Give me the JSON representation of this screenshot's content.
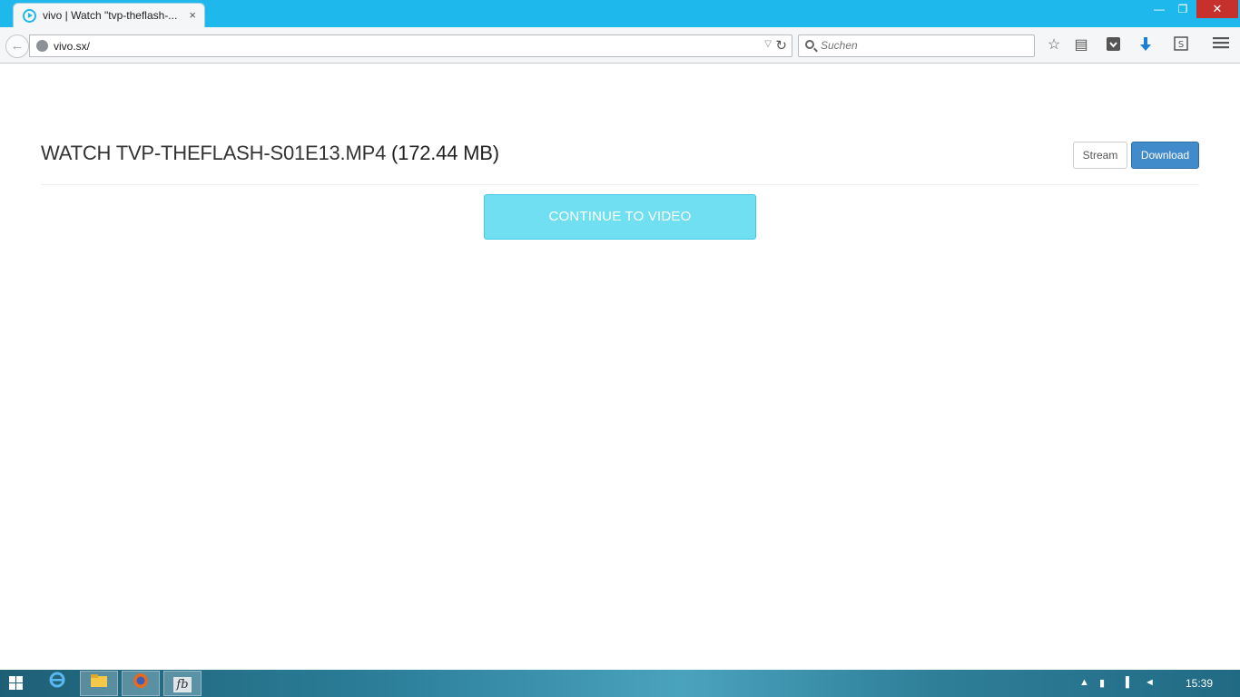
{
  "browser": {
    "tab_title": "vivo | Watch \"tvp-theflash-...",
    "tab_close": "×",
    "window_controls": {
      "minimize": "—",
      "maximize": "❐",
      "close": "✕"
    },
    "url": "vivo.sx/",
    "search_placeholder": "Suchen",
    "toolbar_icons": [
      "back-icon",
      "bookmark-star-icon",
      "reading-list-icon",
      "pocket-icon",
      "download-arrow-icon",
      "screenshot-icon",
      "hamburger-menu-icon"
    ]
  },
  "page": {
    "heading_prefix": "WATCH TVP-THEFLASH-S01E13.MP4",
    "heading_size": "(172.44 MB)",
    "stream_label": "Stream",
    "download_label": "Download",
    "continue_label": "CONTINUE TO VIDEO",
    "colors": {
      "continue_bg": "#71dff2",
      "download_bg": "#428bca",
      "titlebar": "#1fb8ec"
    }
  },
  "taskbar": {
    "apps": [
      "internet-explorer-icon",
      "file-explorer-icon",
      "firefox-icon",
      "fb-app-icon"
    ],
    "active_app": "firefox-icon",
    "fb_label": "fb",
    "clock": "15:39"
  }
}
